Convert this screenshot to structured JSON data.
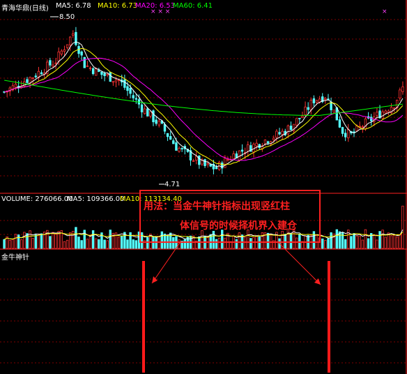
{
  "header": {
    "stock_name": "青海华鼎(日线)",
    "ma5_label": "MA5: 6.78",
    "ma10_label": "MA10: 6.73",
    "ma20_label": "MA20: 6.53",
    "ma60_label": "MA60: 6.41",
    "markers": "× × ×",
    "marker_right": "×"
  },
  "annotations": {
    "high": "8.50",
    "low": "4.71"
  },
  "volume_header": {
    "volume_label": "VOLUME: 276066.00",
    "ma5_label": "MA5: 109366.00",
    "ma10_label": "MA10: 113134.40"
  },
  "indicator_header": {
    "name": "金牛神针"
  },
  "note": {
    "line1_prefix": "用法",
    "line1_rest": "：当金牛神针指标出现竖红柱",
    "line2": "体信号的时候择机界入建仓"
  },
  "colors": {
    "background": "#000000",
    "up": "#ff3232",
    "down": "#54ffff",
    "ma5": "#ffffff",
    "ma10": "#ffff00",
    "ma20": "#ff00ff",
    "ma60": "#00ff00",
    "grid": "#800000",
    "note_text": "#ff2020"
  },
  "chart_data": [
    {
      "type": "candlestick",
      "title": "青海华鼎(日线)",
      "price_high": 8.5,
      "price_low": 4.71,
      "series_summary": {
        "MA5": 6.78,
        "MA10": 6.73,
        "MA20": 6.53,
        "MA60": 6.41
      },
      "ylim": [
        4.4,
        9.0
      ],
      "grid": true
    },
    {
      "type": "bar",
      "title": "VOLUME",
      "volume": 276066.0,
      "MA5": 109366.0,
      "MA10": 113134.4,
      "ylim": [
        0,
        300000
      ]
    },
    {
      "type": "bar",
      "title": "金牛神针",
      "signals": [
        1,
        1
      ],
      "values": [
        1,
        1
      ],
      "ylim": [
        0,
        1
      ]
    }
  ]
}
